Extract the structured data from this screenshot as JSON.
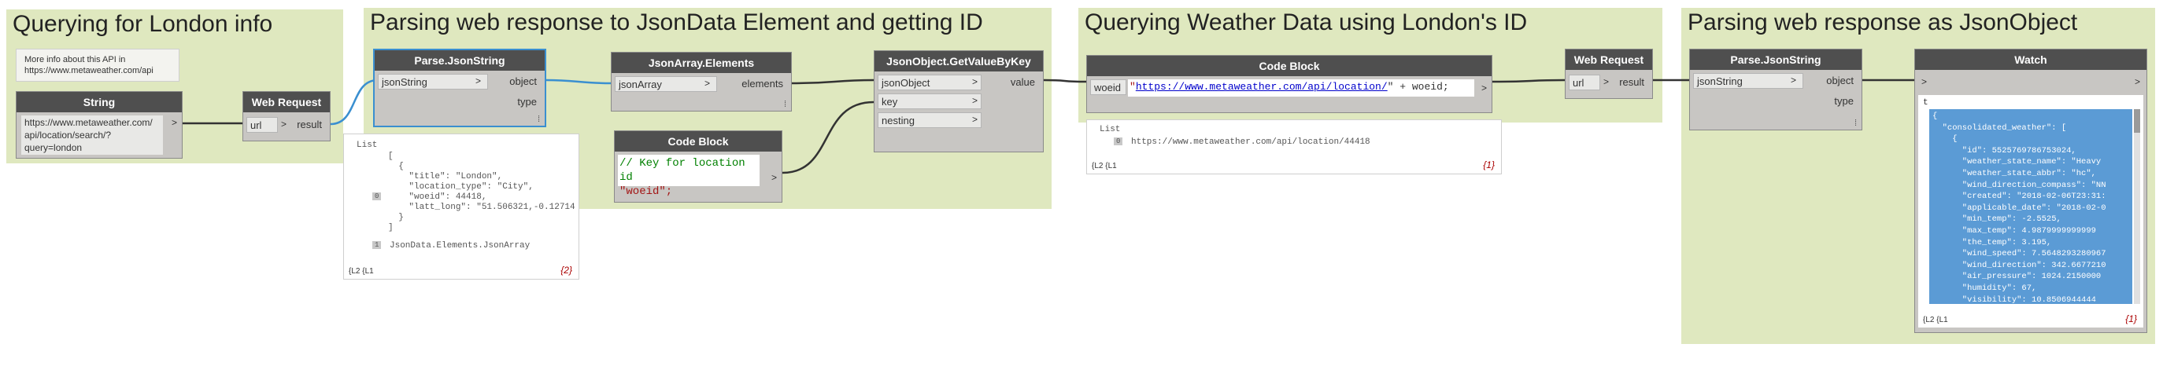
{
  "groups": [
    {
      "title": "Querying for London info"
    },
    {
      "title": "Parsing web response to JsonData Element and getting ID"
    },
    {
      "title": "Querying Weather Data using London's ID"
    },
    {
      "title": "Parsing web response as JsonObject"
    }
  ],
  "note": {
    "text": "More info about this API in https://www.metaweather.com/api"
  },
  "nodes": {
    "string": {
      "title": "String",
      "value_l1": "https://www.metaweather.com/",
      "value_l2": "api/location/search/?",
      "value_l3": "query=london",
      "out": ">"
    },
    "web_request_1": {
      "title": "Web Request",
      "in": "url",
      "out": "result"
    },
    "parse_json_1": {
      "title": "Parse.JsonString",
      "in": "jsonString",
      "out1": "object",
      "out2": "type"
    },
    "json_array_elements": {
      "title": "JsonArray.Elements",
      "in": "jsonArray",
      "out": "elements"
    },
    "code_block_1": {
      "title": "Code Block",
      "line1": "// Key for location id",
      "line2": "\"woeid\";"
    },
    "get_value_by_key": {
      "title": "JsonObject.GetValueByKey",
      "in1": "jsonObject",
      "in2": "key",
      "in3": "nesting",
      "out": "value"
    },
    "code_block_2": {
      "title": "Code Block",
      "param": "woeid",
      "code_pre": "\"",
      "code_link": "https://www.metaweather.com/api/location/",
      "code_post": "\" + woeid;"
    },
    "web_request_2": {
      "title": "Web Request",
      "in": "url",
      "out": "result"
    },
    "parse_json_2": {
      "title": "Parse.JsonString",
      "in": "jsonString",
      "out1": "object",
      "out2": "type"
    },
    "watch": {
      "title": "Watch"
    }
  },
  "previews": {
    "list1": {
      "header": "List",
      "lines": [
        "[",
        "  {",
        "    \"title\": \"London\",",
        "    \"location_type\": \"City\",",
        "    \"woeid\": 44418,",
        "    \"latt_long\": \"51.506321,-0.12714",
        "  }",
        "]"
      ],
      "index0": "0",
      "index1": "1",
      "item1": "JsonData.Elements.JsonArray",
      "lacing": "{L2 {L1",
      "count": "{2}"
    },
    "list2": {
      "header": "List",
      "index0": "0",
      "item0": "https://www.metaweather.com/api/location/44418",
      "lacing": "{L2 {L1",
      "count": "{1}"
    },
    "watch": {
      "prefix": "t",
      "lines": [
        "{",
        "  \"consolidated_weather\": [",
        "    {",
        "      \"id\": 5525769786753024,",
        "      \"weather_state_name\": \"Heavy",
        "      \"weather_state_abbr\": \"hc\",",
        "      \"wind_direction_compass\": \"NN",
        "      \"created\": \"2018-02-06T23:31:",
        "      \"applicable_date\": \"2018-02-0",
        "      \"min_temp\": -2.5525,",
        "      \"max_temp\": 4.9879999999999",
        "      \"the_temp\": 3.195,",
        "      \"wind_speed\": 7.5648293280967",
        "      \"wind_direction\": 342.6677210",
        "      \"air_pressure\": 1024.2150000",
        "      \"humidity\": 67,",
        "      \"visibility\": 10.8506944444"
      ],
      "lacing": "{L2 {L1",
      "count": "{1}"
    }
  },
  "colors": {
    "group_bg": "#dfe8bf",
    "node_header": "#4f4f4f",
    "node_body": "#c8c6c3",
    "selected_wire": "#3a8fd0",
    "watch_bg": "#5b9bd5"
  }
}
